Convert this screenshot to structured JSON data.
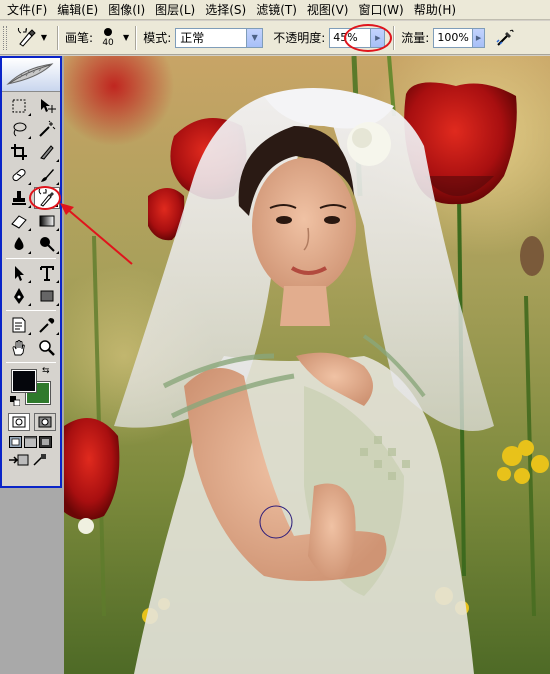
{
  "menu": {
    "items": [
      {
        "label": "文件(F)"
      },
      {
        "label": "编辑(E)"
      },
      {
        "label": "图像(I)"
      },
      {
        "label": "图层(L)"
      },
      {
        "label": "选择(S)"
      },
      {
        "label": "滤镜(T)"
      },
      {
        "label": "视图(V)"
      },
      {
        "label": "窗口(W)"
      },
      {
        "label": "帮助(H)"
      }
    ]
  },
  "options": {
    "brush_label": "画笔:",
    "brush_size": "40",
    "mode_label": "模式:",
    "mode_value": "正常",
    "opacity_label": "不透明度:",
    "opacity_value": "45%",
    "flow_label": "流量:",
    "flow_value": "100%",
    "active_tool_icon": "history-brush-icon",
    "airbrush_icon": "airbrush-icon"
  },
  "toolbox": {
    "foreground_color": "#05060c",
    "background_color": "#2f7a2c",
    "active_tool": "history-brush-icon",
    "tools": [
      "marquee-icon",
      "move-icon",
      "lasso-icon",
      "magic-wand-icon",
      "crop-icon",
      "slice-icon",
      "healing-brush-icon",
      "brush-icon",
      "clone-stamp-icon",
      "history-brush-icon",
      "eraser-icon",
      "gradient-icon",
      "blur-icon",
      "dodge-icon",
      "path-selection-icon",
      "type-icon",
      "pen-icon",
      "rectangle-shape-icon",
      "notes-icon",
      "eyedropper-icon",
      "hand-icon",
      "zoom-icon"
    ]
  },
  "annotations": {
    "highlight_color": "#e0141c"
  }
}
